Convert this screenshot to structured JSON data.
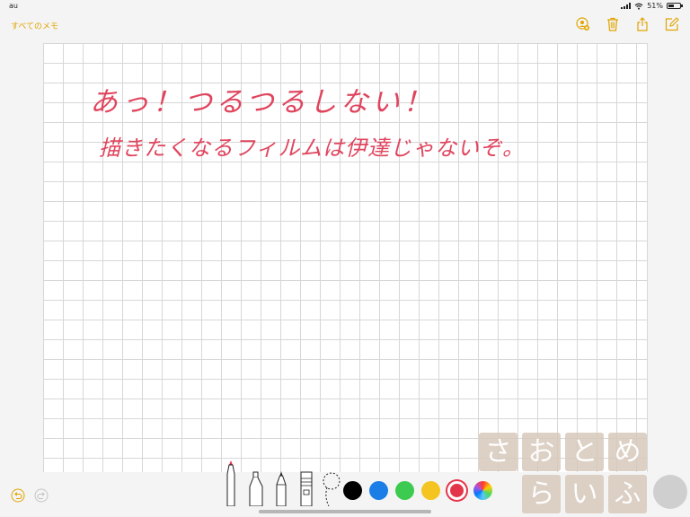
{
  "status_bar": {
    "carrier": "au",
    "battery_percent": "51%"
  },
  "nav": {
    "back_label": "すべてのメモ"
  },
  "note": {
    "line1": "あっ！つるつるしない！",
    "line2": "描きたくなるフィルムは伊達じゃないぞ。"
  },
  "colors": {
    "accent": "#e0a400",
    "ink": "#e0455e",
    "swatches": [
      "#000000",
      "#1a7ee6",
      "#3ccb50",
      "#f4c421",
      "#e4364a"
    ]
  },
  "watermark": {
    "row1": [
      "さ",
      "お",
      "と",
      "め"
    ],
    "row2": [
      "ら",
      "い",
      "ふ"
    ]
  }
}
